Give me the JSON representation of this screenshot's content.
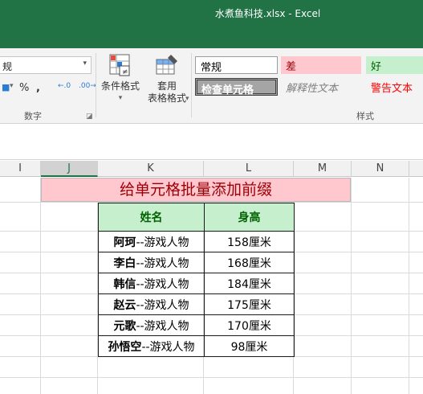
{
  "window": {
    "title": "水煮鱼科技.xlsx - Excel"
  },
  "ribbon": {
    "number_format_value": "规",
    "percent_symbol": "%",
    "comma_symbol": ",",
    "inc_decimal": "←.0",
    "dec_decimal": ".00→",
    "number_group_label": "数字",
    "conditional_format_label": "条件格式",
    "table_format_label_1": "套用",
    "table_format_label_2": "表格格式",
    "styles_group_label": "样式",
    "styles": {
      "normal": "常规",
      "bad": "差",
      "good": "好",
      "check_cell": "检查单元格",
      "explanatory": "解释性文本",
      "warning": "警告文本"
    },
    "colors": {
      "bad_bg": "#ffc7ce",
      "bad_fg": "#9c0006",
      "good_bg": "#c6efce",
      "good_fg": "#006100",
      "warning_fg": "#ff0000"
    }
  },
  "columns": [
    "I",
    "J",
    "K",
    "L",
    "M",
    "N"
  ],
  "selected_column": "J",
  "sheet": {
    "banner": "给单元格批量添加前缀",
    "headers": [
      "姓名",
      "身高"
    ],
    "rows": [
      {
        "name": "阿珂",
        "suffix": "--游戏人物",
        "height": "158厘米"
      },
      {
        "name": "李白",
        "suffix": "--游戏人物",
        "height": "168厘米"
      },
      {
        "name": "韩信",
        "suffix": "--游戏人物",
        "height": "184厘米"
      },
      {
        "name": "赵云",
        "suffix": "--游戏人物",
        "height": "175厘米"
      },
      {
        "name": "元歌",
        "suffix": "--游戏人物",
        "height": "170厘米"
      },
      {
        "name": "孙悟空",
        "suffix": "--游戏人物",
        "height": "98厘米"
      }
    ]
  }
}
